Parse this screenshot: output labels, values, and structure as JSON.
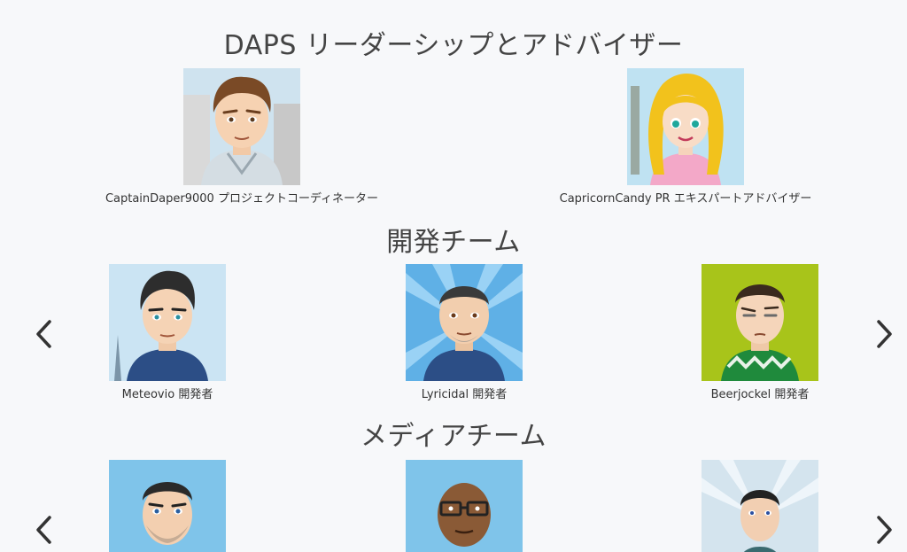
{
  "leadership": {
    "title": "DAPS リーダーシップとアドバイザー",
    "members": [
      {
        "name": "CaptainDaper9000",
        "role": "プロジェクトコーディネーター"
      },
      {
        "name": "CapricornCandy PR",
        "role": "エキスパートアドバイザー"
      }
    ]
  },
  "dev": {
    "title": "開発チーム",
    "members": [
      {
        "name": "Meteovio",
        "role": "開発者"
      },
      {
        "name": "Lyricidal",
        "role": "開発者"
      },
      {
        "name": "Beerjockel",
        "role": "開発者"
      }
    ]
  },
  "media": {
    "title": "メディアチーム"
  },
  "icons": {
    "prev": "chevron-left-icon",
    "next": "chevron-right-icon"
  },
  "colors": {
    "background": "#f7f8fa",
    "text": "#333333",
    "arrow": "#333333",
    "sky_blue": "#7fc4ea",
    "lime": "#a8c41a",
    "hoodie": "#2c4e86"
  }
}
